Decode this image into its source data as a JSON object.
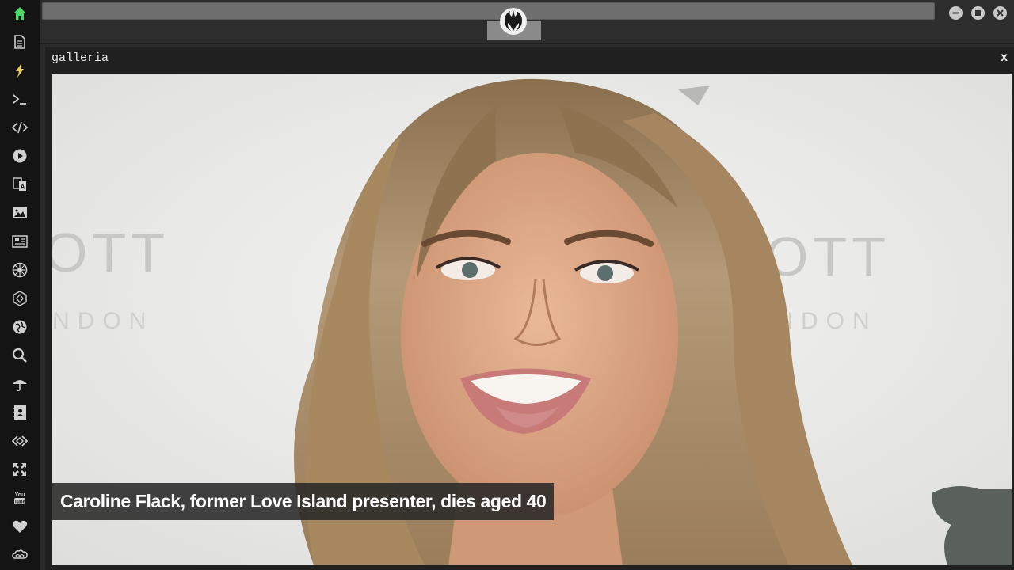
{
  "window": {
    "logo_icon": "rebel-alliance-icon"
  },
  "sidebar": {
    "accent_color": "#4cd964",
    "icon_color": "#d0d0d0",
    "items": [
      {
        "icon": "home-icon",
        "active": true
      },
      {
        "icon": "document-icon"
      },
      {
        "icon": "lightning-icon",
        "highlight": "#e8d44d"
      },
      {
        "icon": "terminal-icon"
      },
      {
        "icon": "code-icon"
      },
      {
        "icon": "play-icon"
      },
      {
        "icon": "translate-icon"
      },
      {
        "icon": "image-icon"
      },
      {
        "icon": "newspaper-icon"
      },
      {
        "icon": "galactic-empire-icon"
      },
      {
        "icon": "hexagon-icon"
      },
      {
        "icon": "globe-icon"
      },
      {
        "icon": "search-icon"
      },
      {
        "icon": "umbrella-icon"
      },
      {
        "icon": "contacts-icon"
      },
      {
        "icon": "embed-icon"
      },
      {
        "icon": "expand-icon"
      },
      {
        "icon": "youtube-icon"
      },
      {
        "icon": "heart-icon"
      },
      {
        "icon": "infinity-cloud-icon"
      }
    ]
  },
  "panel": {
    "title": "galleria",
    "close_label": "x",
    "caption": "Caroline Flack, former Love Island presenter, dies aged 40",
    "background_text_left": "OTT",
    "background_text_left_sub": "NDON",
    "background_text_right": "OTT",
    "background_text_right_sub": "ONDON"
  }
}
